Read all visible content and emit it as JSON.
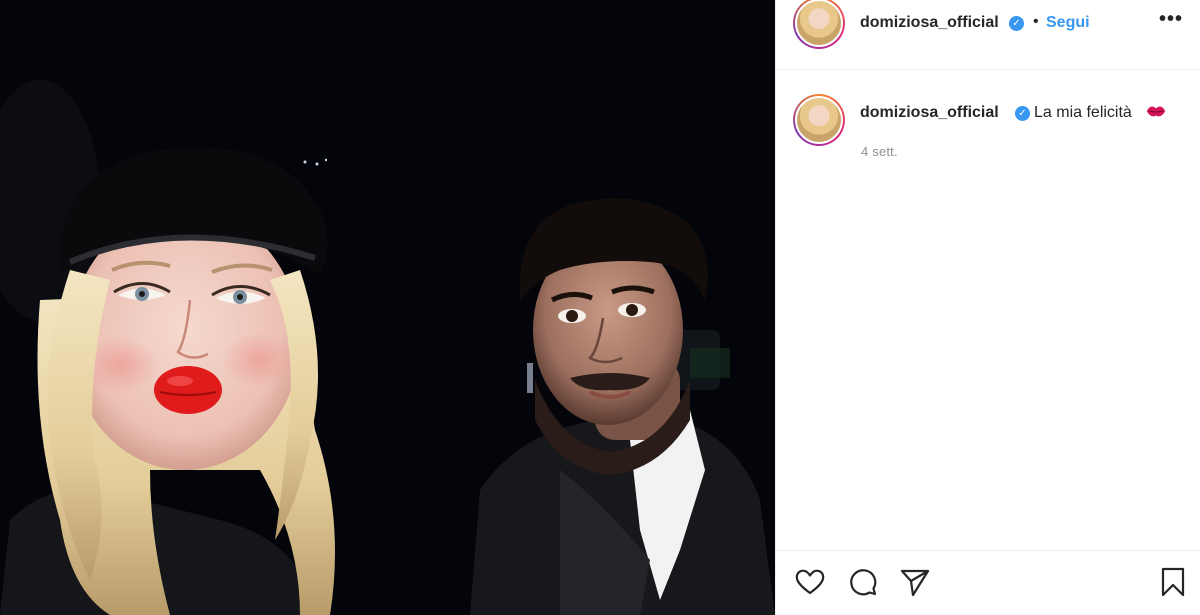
{
  "post": {
    "username": "domiziosa_official",
    "follow_label": "Segui",
    "separator": "•",
    "more_label": "•••",
    "caption": "La mia felicità",
    "caption_emoji": "kiss-mark-icon",
    "timestamp": "4 sett."
  },
  "photo": {
    "description_icon": "photo",
    "lipstick_color": "#e01b1b"
  },
  "actions": {
    "like_icon": "heart-icon",
    "comment_icon": "comment-icon",
    "share_icon": "paper-plane-icon",
    "save_icon": "bookmark-icon"
  },
  "colors": {
    "accent": "#3897f0",
    "text": "#262626",
    "muted": "#8e8e8e",
    "divider": "#efefef"
  }
}
